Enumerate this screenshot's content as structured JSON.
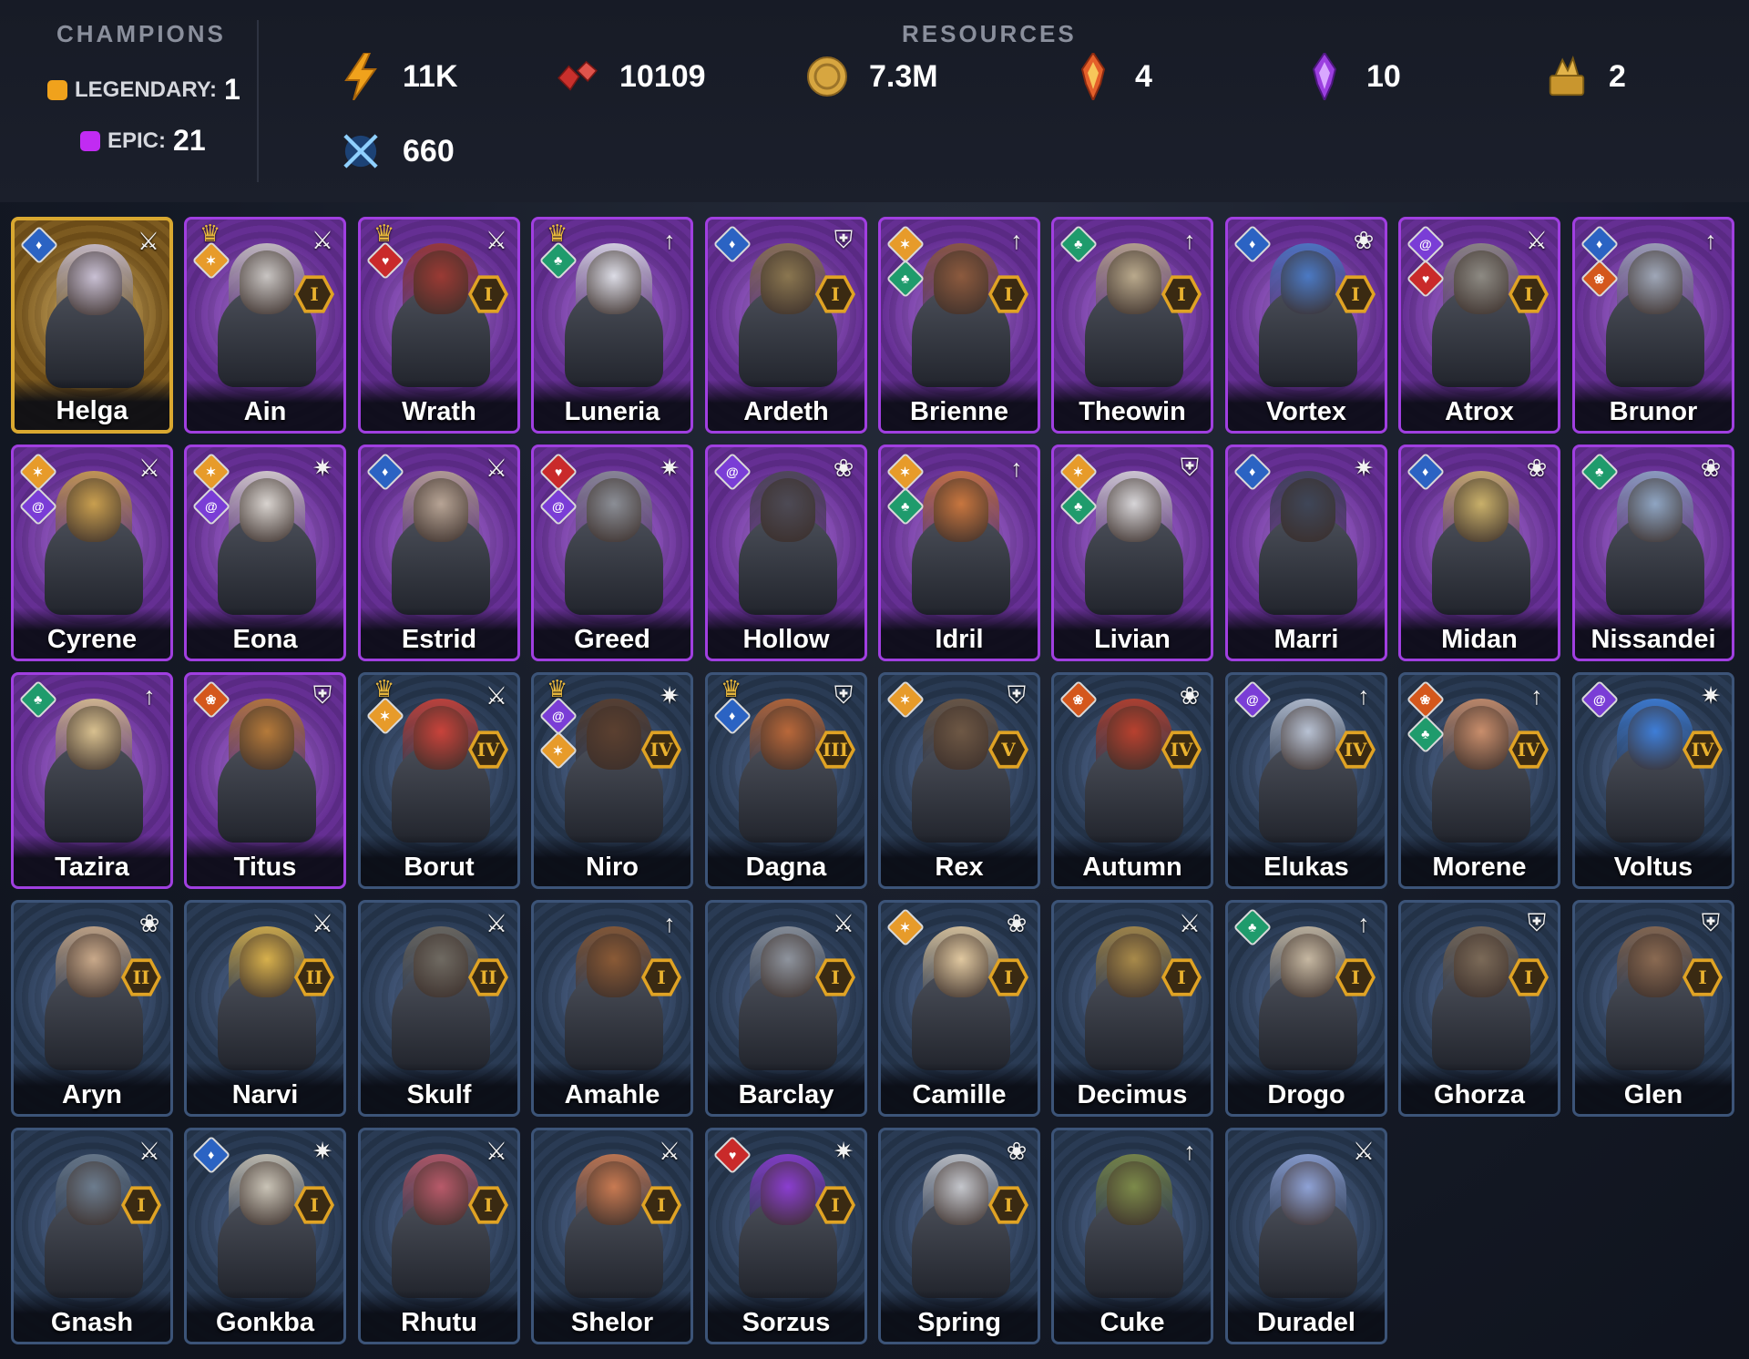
{
  "header": {
    "champions_title": "CHAMPIONS",
    "legendary_label": "LEGENDARY:",
    "legendary_count": "1",
    "epic_label": "EPIC:",
    "epic_count": "21",
    "resources_title": "RESOURCES",
    "resources": [
      {
        "icon": "lightning-icon",
        "value": "11K",
        "color": "#f0a21c"
      },
      {
        "icon": "red-gems-icon",
        "value": "10109",
        "color": "#d2413a"
      },
      {
        "icon": "gold-coin-icon",
        "value": "7.3M",
        "color": "#d7a640"
      },
      {
        "icon": "fire-shard-icon",
        "value": "4",
        "color": "#e4602a"
      },
      {
        "icon": "void-shard-icon",
        "value": "10",
        "color": "#a548e6"
      },
      {
        "icon": "gold-pile-icon",
        "value": "2",
        "color": "#e2b34a"
      },
      {
        "icon": "crossed-swords-icon",
        "value": "660",
        "color": "#4aa3e6"
      }
    ]
  },
  "champions": [
    {
      "name": "Helga",
      "rarity": "legendary",
      "role": "attack",
      "affinities": [
        "blue"
      ],
      "crown": false,
      "star": "",
      "tone": "#c9c0d4"
    },
    {
      "name": "Ain",
      "rarity": "epic",
      "role": "attack",
      "affinities": [
        "orange"
      ],
      "crown": true,
      "star": "I",
      "tone": "#c8c4c2"
    },
    {
      "name": "Wrath",
      "rarity": "epic",
      "role": "attack",
      "affinities": [
        "red"
      ],
      "crown": true,
      "star": "I",
      "tone": "#9a3a34"
    },
    {
      "name": "Luneria",
      "rarity": "epic",
      "role": "ranged",
      "affinities": [
        "green"
      ],
      "crown": true,
      "star": "",
      "tone": "#dcdce6"
    },
    {
      "name": "Ardeth",
      "rarity": "epic",
      "role": "defense",
      "affinities": [
        "blue"
      ],
      "crown": false,
      "star": "I",
      "tone": "#8a7650"
    },
    {
      "name": "Brienne",
      "rarity": "epic",
      "role": "ranged",
      "affinities": [
        "orange",
        "green"
      ],
      "crown": false,
      "star": "I",
      "tone": "#8c5a3e"
    },
    {
      "name": "Theowin",
      "rarity": "epic",
      "role": "ranged",
      "affinities": [
        "green"
      ],
      "crown": false,
      "star": "I",
      "tone": "#b9a98c"
    },
    {
      "name": "Vortex",
      "rarity": "epic",
      "role": "support",
      "affinities": [
        "blue"
      ],
      "crown": false,
      "star": "I",
      "tone": "#4b79c4"
    },
    {
      "name": "Atrox",
      "rarity": "epic",
      "role": "attack",
      "affinities": [
        "purple",
        "red"
      ],
      "crown": false,
      "star": "I",
      "tone": "#8d8a83"
    },
    {
      "name": "Brunor",
      "rarity": "epic",
      "role": "ranged",
      "affinities": [
        "blue",
        "fire"
      ],
      "crown": false,
      "star": "",
      "tone": "#9fa7b8"
    },
    {
      "name": "Cyrene",
      "rarity": "epic",
      "role": "attack",
      "affinities": [
        "orange",
        "purple"
      ],
      "crown": false,
      "star": "",
      "tone": "#c99f4f"
    },
    {
      "name": "Eona",
      "rarity": "epic",
      "role": "magic",
      "affinities": [
        "orange",
        "purple"
      ],
      "crown": false,
      "star": "",
      "tone": "#d8d3cf"
    },
    {
      "name": "Estrid",
      "rarity": "epic",
      "role": "attack",
      "affinities": [
        "blue"
      ],
      "crown": false,
      "star": "",
      "tone": "#b7a495"
    },
    {
      "name": "Greed",
      "rarity": "epic",
      "role": "magic",
      "affinities": [
        "red",
        "purple"
      ],
      "crown": false,
      "star": "",
      "tone": "#8b8e96"
    },
    {
      "name": "Hollow",
      "rarity": "epic",
      "role": "support",
      "affinities": [
        "purple"
      ],
      "crown": false,
      "star": "",
      "tone": "#4d4a55"
    },
    {
      "name": "Idril",
      "rarity": "epic",
      "role": "ranged",
      "affinities": [
        "orange",
        "green"
      ],
      "crown": false,
      "star": "",
      "tone": "#c8763f"
    },
    {
      "name": "Livian",
      "rarity": "epic",
      "role": "defense",
      "affinities": [
        "orange",
        "green"
      ],
      "crown": false,
      "star": "",
      "tone": "#d7d5d8"
    },
    {
      "name": "Marri",
      "rarity": "epic",
      "role": "magic",
      "affinities": [
        "blue"
      ],
      "crown": false,
      "star": "",
      "tone": "#3f4658"
    },
    {
      "name": "Midan",
      "rarity": "epic",
      "role": "support",
      "affinities": [
        "blue"
      ],
      "crown": false,
      "star": "",
      "tone": "#c9b06a"
    },
    {
      "name": "Nissandei",
      "rarity": "epic",
      "role": "support",
      "affinities": [
        "green"
      ],
      "crown": false,
      "star": "",
      "tone": "#8fa5c3"
    },
    {
      "name": "Tazira",
      "rarity": "epic",
      "role": "ranged",
      "affinities": [
        "green"
      ],
      "crown": false,
      "star": "",
      "tone": "#d8c08f"
    },
    {
      "name": "Titus",
      "rarity": "epic",
      "role": "defense",
      "affinities": [
        "fire"
      ],
      "crown": false,
      "star": "",
      "tone": "#b57a3a"
    },
    {
      "name": "Borut",
      "rarity": "rare",
      "role": "attack",
      "affinities": [
        "orange"
      ],
      "crown": true,
      "star": "IV",
      "tone": "#c9433b"
    },
    {
      "name": "Niro",
      "rarity": "rare",
      "role": "magic",
      "affinities": [
        "purple",
        "orange"
      ],
      "crown": true,
      "star": "IV",
      "tone": "#5b4030"
    },
    {
      "name": "Dagna",
      "rarity": "rare",
      "role": "defense",
      "affinities": [
        "blue"
      ],
      "crown": true,
      "star": "III",
      "tone": "#b9683a"
    },
    {
      "name": "Rex",
      "rarity": "rare",
      "role": "defense",
      "affinities": [
        "orange"
      ],
      "crown": false,
      "star": "V",
      "tone": "#6e5845"
    },
    {
      "name": "Autumn",
      "rarity": "rare",
      "role": "support",
      "affinities": [
        "fire"
      ],
      "crown": false,
      "star": "IV",
      "tone": "#b8412f"
    },
    {
      "name": "Elukas",
      "rarity": "rare",
      "role": "ranged",
      "affinities": [
        "purple"
      ],
      "crown": false,
      "star": "IV",
      "tone": "#b8c2d4"
    },
    {
      "name": "Morene",
      "rarity": "rare",
      "role": "ranged",
      "affinities": [
        "fire",
        "green"
      ],
      "crown": false,
      "star": "IV",
      "tone": "#c98e6c"
    },
    {
      "name": "Voltus",
      "rarity": "rare",
      "role": "magic",
      "affinities": [
        "purple"
      ],
      "crown": false,
      "star": "IV",
      "tone": "#3e7ed8"
    },
    {
      "name": "Aryn",
      "rarity": "rare",
      "role": "support",
      "affinities": [],
      "crown": false,
      "star": "II",
      "tone": "#c9a98a"
    },
    {
      "name": "Narvi",
      "rarity": "rare",
      "role": "attack",
      "affinities": [],
      "crown": false,
      "star": "II",
      "tone": "#d7b04c"
    },
    {
      "name": "Skulf",
      "rarity": "rare",
      "role": "attack",
      "affinities": [],
      "crown": false,
      "star": "II",
      "tone": "#6f6a62"
    },
    {
      "name": "Amahle",
      "rarity": "rare",
      "role": "ranged",
      "affinities": [],
      "crown": false,
      "star": "I",
      "tone": "#8a5a36"
    },
    {
      "name": "Barclay",
      "rarity": "rare",
      "role": "attack",
      "affinities": [],
      "crown": false,
      "star": "I",
      "tone": "#8e949e"
    },
    {
      "name": "Camille",
      "rarity": "rare",
      "role": "support",
      "affinities": [
        "orange"
      ],
      "crown": false,
      "star": "I",
      "tone": "#e0c8a0"
    },
    {
      "name": "Decimus",
      "rarity": "rare",
      "role": "attack",
      "affinities": [],
      "crown": false,
      "star": "I",
      "tone": "#a88a4a"
    },
    {
      "name": "Drogo",
      "rarity": "rare",
      "role": "ranged",
      "affinities": [
        "green"
      ],
      "crown": false,
      "star": "I",
      "tone": "#c6b8a2"
    },
    {
      "name": "Ghorza",
      "rarity": "rare",
      "role": "defense",
      "affinities": [],
      "crown": false,
      "star": "I",
      "tone": "#7b6a58"
    },
    {
      "name": "Glen",
      "rarity": "rare",
      "role": "defense",
      "affinities": [],
      "crown": false,
      "star": "I",
      "tone": "#8a6a52"
    },
    {
      "name": "Gnash",
      "rarity": "rare",
      "role": "attack",
      "affinities": [],
      "crown": false,
      "star": "I",
      "tone": "#6c7c8e"
    },
    {
      "name": "Gonkba",
      "rarity": "rare",
      "role": "magic",
      "affinities": [
        "blue"
      ],
      "crown": false,
      "star": "I",
      "tone": "#c9c3b6"
    },
    {
      "name": "Rhutu",
      "rarity": "rare",
      "role": "attack",
      "affinities": [],
      "crown": false,
      "star": "I",
      "tone": "#b85a6a"
    },
    {
      "name": "Shelor",
      "rarity": "rare",
      "role": "attack",
      "affinities": [],
      "crown": false,
      "star": "I",
      "tone": "#c87a52"
    },
    {
      "name": "Sorzus",
      "rarity": "rare",
      "role": "magic",
      "affinities": [
        "red"
      ],
      "crown": false,
      "star": "I",
      "tone": "#8a3ed0"
    },
    {
      "name": "Spring",
      "rarity": "rare",
      "role": "support",
      "affinities": [],
      "crown": false,
      "star": "I",
      "tone": "#c4c6cc"
    },
    {
      "name": "Cuke",
      "rarity": "rare",
      "role": "ranged",
      "affinities": [],
      "crown": false,
      "star": "",
      "tone": "#7c8a4a"
    },
    {
      "name": "Duradel",
      "rarity": "rare",
      "role": "attack",
      "affinities": [],
      "crown": false,
      "star": "",
      "tone": "#8ea2d6"
    }
  ]
}
